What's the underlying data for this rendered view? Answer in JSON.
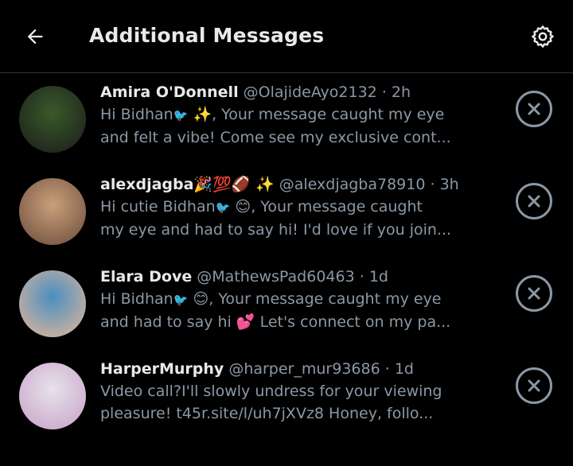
{
  "header": {
    "title": "Additional Messages",
    "back_icon": "arrow-left-icon",
    "settings_icon": "gear-icon"
  },
  "messages": [
    {
      "name": "Amira O'Donnell",
      "handle": "@OlajideAyo2132",
      "time": "2h",
      "line1": "Hi Bidhan",
      "line1_after": " ✨, Your message caught my eye",
      "line2": "and felt a vibe! Come see my exclusive cont...",
      "avatar_colors": [
        "#3a5a2a",
        "#1a1a1a"
      ]
    },
    {
      "name": "alexdjagba🎉💯🏈 ✨",
      "handle": "@alexdjagba78910",
      "time": "3h",
      "line1": "Hi cutie Bidhan",
      "line1_after": " 😊, Your message caught",
      "line2": "my eye and had to say hi! I'd love if you join...",
      "avatar_colors": [
        "#c9a07a",
        "#6a4a3a"
      ]
    },
    {
      "name": "Elara Dove",
      "handle": "@MathewsPad60463",
      "time": "1d",
      "line1": "Hi Bidhan",
      "line1_after": " 😊, Your message caught my eye",
      "line2": "and had to say hi 💕 Let's connect on my pa...",
      "avatar_colors": [
        "#4a8fc0",
        "#e8b89a"
      ]
    },
    {
      "name": "HarperMurphy",
      "handle": "@harper_mur93686",
      "time": "1d",
      "line1": "Video call?I'll slowly undress for your viewing",
      "line1_after": "",
      "line2": "pleasure! t45r.site/l/uh7jXVz8 Honey, follo...",
      "avatar_colors": [
        "#e6e2ea",
        "#c8a0c8"
      ]
    }
  ],
  "separator": "·",
  "bird_glyph": "🐦",
  "dismiss_icon": "close-circle-icon"
}
